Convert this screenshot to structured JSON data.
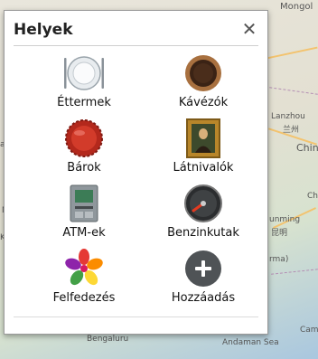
{
  "map": {
    "labels": [
      "Mongol",
      "Lanzhou",
      "兰州",
      "Chin",
      "Ch",
      "unming",
      "昆明",
      "rma)",
      "Bengaluru",
      "Andaman Sea",
      "Cam",
      "ar",
      "M",
      "Ka"
    ]
  },
  "dialog": {
    "title": "Helyek",
    "close_icon": "close-icon",
    "items": [
      {
        "label": "Éttermek",
        "icon": "plate-icon"
      },
      {
        "label": "Kávézók",
        "icon": "coffee-cup-icon"
      },
      {
        "label": "Bárok",
        "icon": "bottle-cap-icon"
      },
      {
        "label": "Látnivalók",
        "icon": "painting-icon"
      },
      {
        "label": "ATM-ek",
        "icon": "atm-icon"
      },
      {
        "label": "Benzinkutak",
        "icon": "fuel-gauge-icon"
      },
      {
        "label": "Felfedezés",
        "icon": "pinwheel-icon"
      },
      {
        "label": "Hozzáadás",
        "icon": "add-icon"
      }
    ]
  }
}
